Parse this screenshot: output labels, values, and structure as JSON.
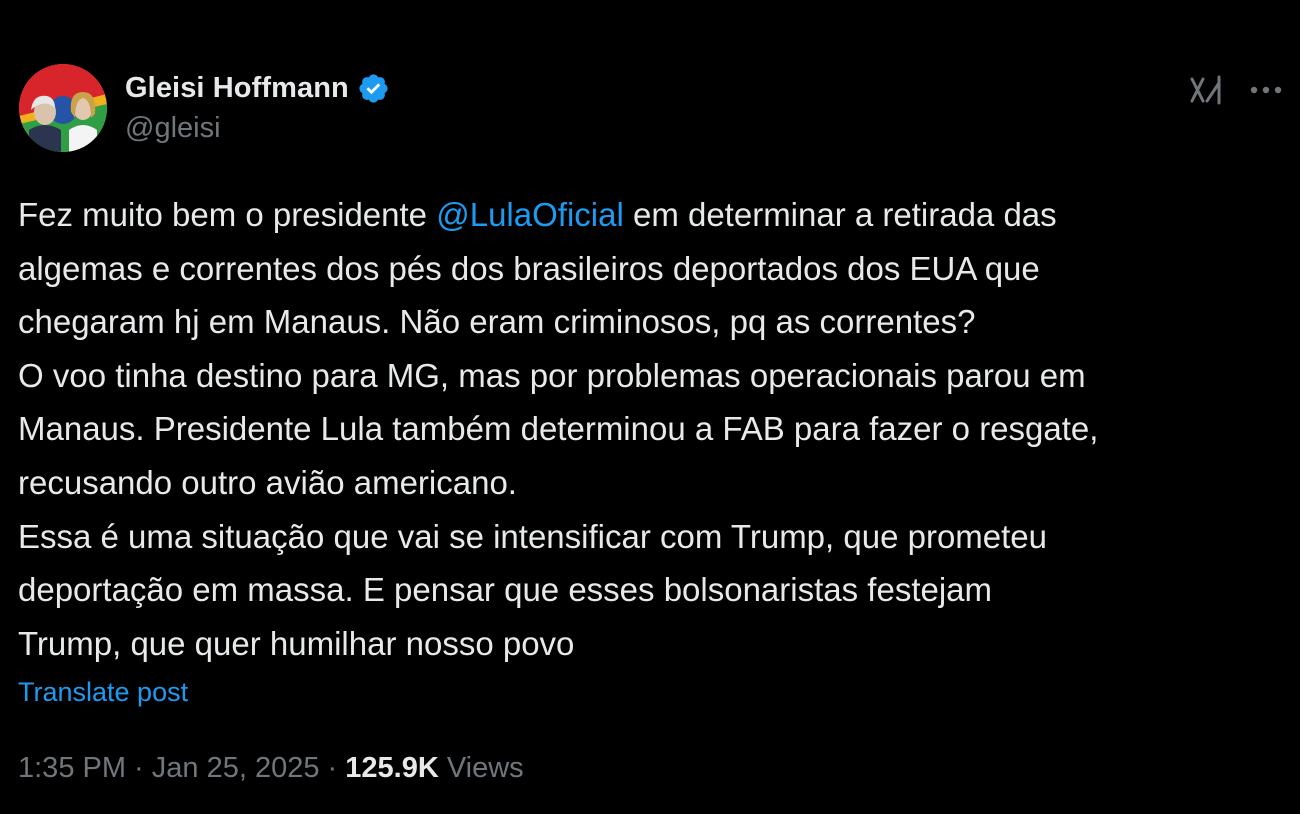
{
  "author": {
    "display_name": "Gleisi Hoffmann",
    "handle": "@gleisi",
    "verified_icon": "verified-badge-icon"
  },
  "tweet": {
    "line1_before": "Fez muito bem o presidente ",
    "line1_mention": "@LulaOficial",
    "line1_after": " em determinar a retirada das",
    "line2": "algemas e correntes dos pés dos brasileiros deportados dos EUA que",
    "line3": "chegaram hj em Manaus. Não eram criminosos, pq as correntes?",
    "line4": "O voo tinha destino para MG, mas por problemas operacionais parou em",
    "line5": "Manaus. Presidente Lula também determinou a FAB para fazer o resgate,",
    "line6": "recusando outro avião americano.",
    "line7": "Essa é uma situação que vai se intensificar com Trump, que prometeu",
    "line8": "deportação em massa. E pensar que esses bolsonaristas festejam",
    "line9": "Trump, que quer humilhar nosso povo"
  },
  "translate_label": "Translate post",
  "meta": {
    "time": "1:35 PM",
    "separator": " · ",
    "date": "Jan 25, 2025",
    "views_count": "125.9K",
    "views_label": " Views"
  },
  "icons": {
    "grok": "grok-icon",
    "more": "more-options-icon"
  },
  "colors": {
    "background": "#000000",
    "text": "#e7e9ea",
    "muted": "#71767b",
    "accent": "#1d9bf0"
  }
}
